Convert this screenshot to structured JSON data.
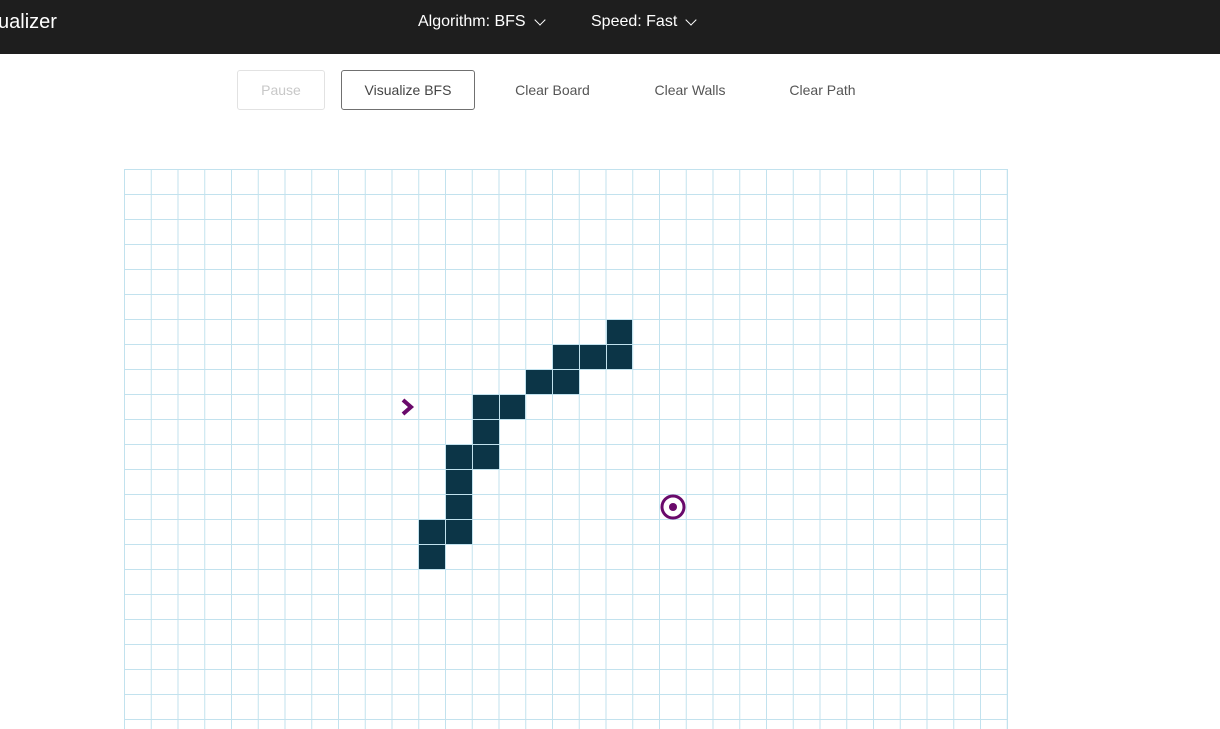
{
  "navbar": {
    "brand": "ualizer",
    "algorithm_label": "Algorithm: BFS",
    "speed_label": "Speed: Fast"
  },
  "toolbar": {
    "pause_label": "Pause",
    "visualize_label": "Visualize BFS",
    "clear_board_label": "Clear Board",
    "clear_walls_label": "Clear Walls",
    "clear_path_label": "Clear Path"
  },
  "grid": {
    "visible_columns": 33,
    "visible_rows": 22,
    "start_node": {
      "col": 10,
      "row": 9
    },
    "target_node": {
      "col": 20,
      "row": 13
    },
    "walls": [
      {
        "col": 18,
        "row": 6
      },
      {
        "col": 16,
        "row": 7
      },
      {
        "col": 17,
        "row": 7
      },
      {
        "col": 18,
        "row": 7
      },
      {
        "col": 15,
        "row": 8
      },
      {
        "col": 16,
        "row": 8
      },
      {
        "col": 13,
        "row": 9
      },
      {
        "col": 14,
        "row": 9
      },
      {
        "col": 13,
        "row": 10
      },
      {
        "col": 12,
        "row": 11
      },
      {
        "col": 13,
        "row": 11
      },
      {
        "col": 12,
        "row": 12
      },
      {
        "col": 12,
        "row": 13
      },
      {
        "col": 11,
        "row": 14
      },
      {
        "col": 12,
        "row": 14
      },
      {
        "col": 11,
        "row": 15
      }
    ]
  },
  "colors": {
    "navbar_bg": "#1e1e1e",
    "wall": "#0c3547",
    "grid_line": "#c2e2ee",
    "node_accent": "#6a0a6b"
  }
}
